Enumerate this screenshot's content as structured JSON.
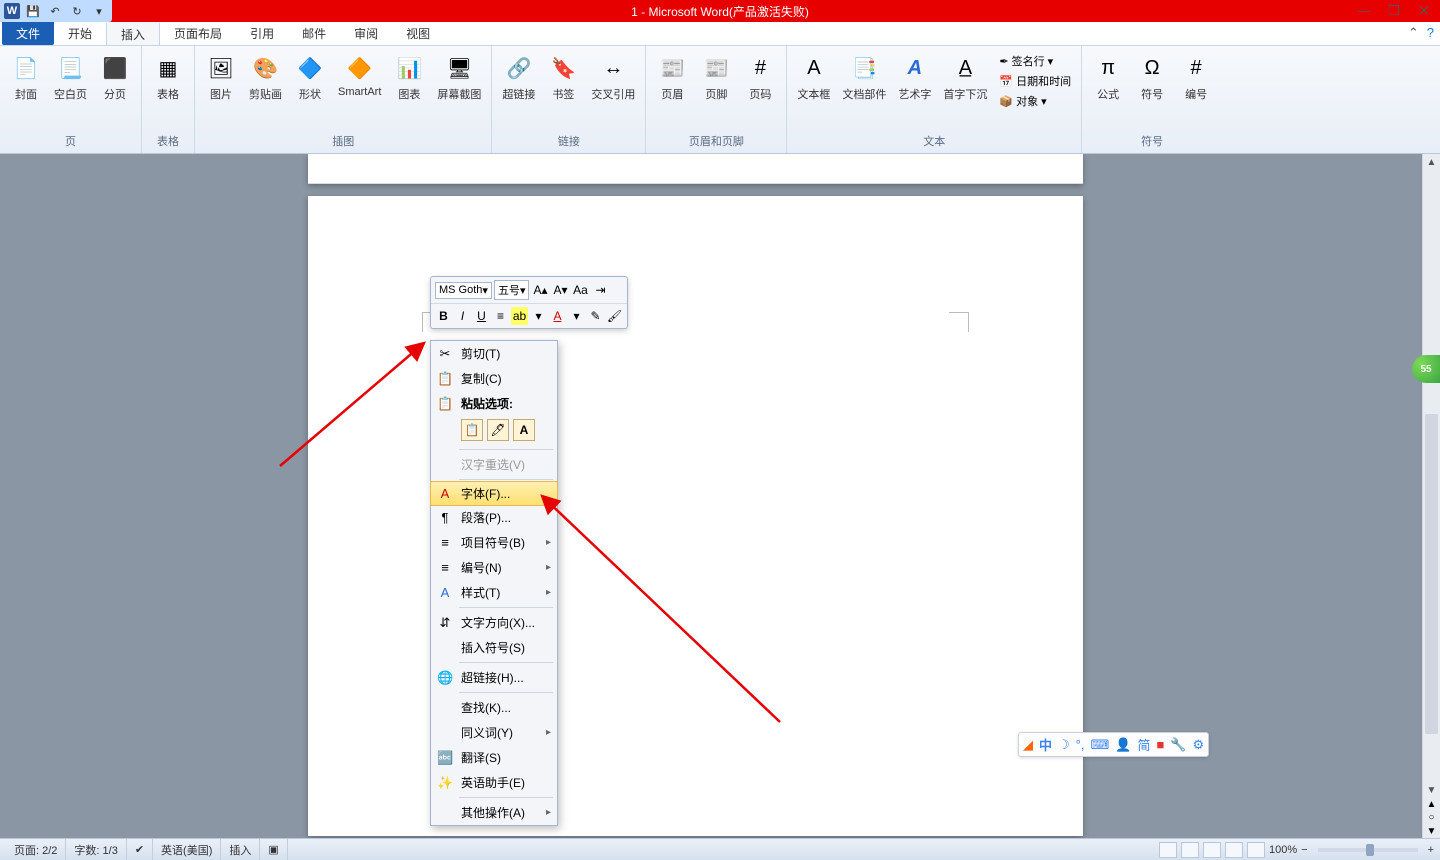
{
  "title": "1 - Microsoft Word(产品激活失败)",
  "tabs": {
    "file": "文件",
    "home": "开始",
    "insert": "插入",
    "layout": "页面布局",
    "ref": "引用",
    "mail": "邮件",
    "review": "审阅",
    "view": "视图"
  },
  "ribbon": {
    "pages": {
      "name": "页",
      "cover": "封面",
      "blank": "空白页",
      "break": "分页"
    },
    "tables": {
      "name": "表格",
      "table": "表格"
    },
    "illus": {
      "name": "插图",
      "pic": "图片",
      "clip": "剪贴画",
      "shape": "形状",
      "smart": "SmartArt",
      "chart": "图表",
      "screen": "屏幕截图"
    },
    "links": {
      "name": "链接",
      "hyper": "超链接",
      "book": "书签",
      "cross": "交叉引用"
    },
    "hf": {
      "name": "页眉和页脚",
      "header": "页眉",
      "footer": "页脚",
      "pagenum": "页码"
    },
    "text": {
      "name": "文本",
      "textbox": "文本框",
      "quick": "文档部件",
      "wordart": "艺术字",
      "dropcap": "首字下沉",
      "sig": "签名行",
      "dt": "日期和时间",
      "obj": "对象"
    },
    "sym": {
      "name": "符号",
      "eq": "公式",
      "symb": "符号",
      "num": "编号"
    }
  },
  "minitb": {
    "font": "MS Goth",
    "size": "五号"
  },
  "ctx": {
    "cut": "剪切(T)",
    "copy": "复制(C)",
    "pastehdr": "粘贴选项:",
    "reselect": "汉字重选(V)",
    "font": "字体(F)...",
    "para": "段落(P)...",
    "bullet": "项目符号(B)",
    "numbering": "编号(N)",
    "style": "样式(T)",
    "textdir": "文字方向(X)...",
    "insertsym": "插入符号(S)",
    "hyperlink": "超链接(H)...",
    "find": "查找(K)...",
    "synonym": "同义词(Y)",
    "translate": "翻译(S)",
    "enghelp": "英语助手(E)",
    "other": "其他操作(A)"
  },
  "ime": {
    "ch": "中",
    "simp": "简"
  },
  "status": {
    "page": "页面: 2/2",
    "words": "字数: 1/3",
    "lang": "英语(美国)",
    "mode": "插入",
    "zoom": "100%"
  },
  "badge": "55",
  "colors": {
    "accent": "#e60000",
    "ribbon_active": "#1a5fb4"
  }
}
